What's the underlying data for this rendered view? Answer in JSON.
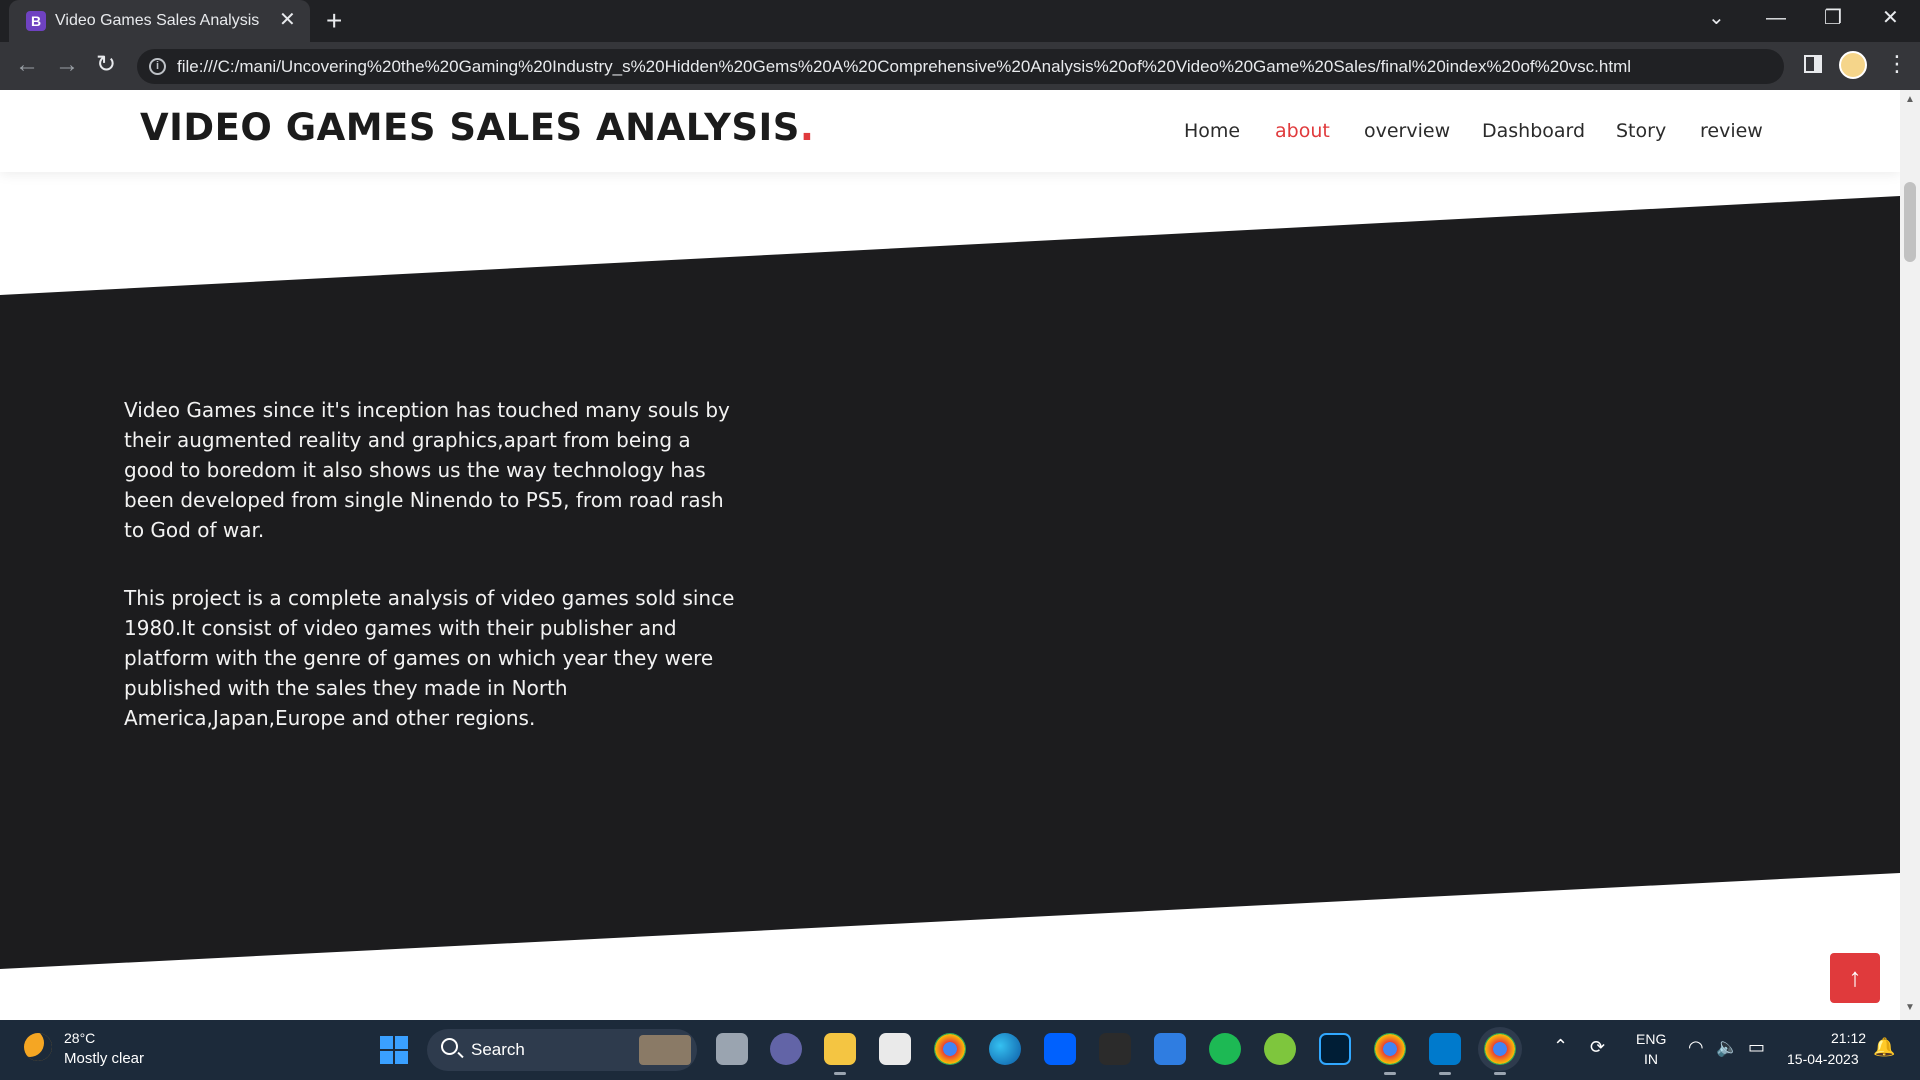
{
  "browser": {
    "tab_title": "Video Games Sales Analysis",
    "tab_favicon_letter": "B",
    "url": "file:///C:/mani/Uncovering%20the%20Gaming%20Industry_s%20Hidden%20Gems%20A%20Comprehensive%20Analysis%20of%20Video%20Game%20Sales/final%20index%20of%20vsc.html"
  },
  "site": {
    "logo_text": "VIDEO GAMES SALES ANALYSIS",
    "logo_dot": ".",
    "nav": [
      {
        "label": "Home",
        "active": false
      },
      {
        "label": "about",
        "active": true
      },
      {
        "label": "overview",
        "active": false
      },
      {
        "label": "Dashboard",
        "active": false
      },
      {
        "label": "Story",
        "active": false
      },
      {
        "label": "review",
        "active": false
      }
    ],
    "about_paragraphs": [
      "Video Games since it's inception has touched many souls by their augmented reality and graphics,apart from being a good to boredom it also shows us the way technology has been developed from single Ninendo to PS5, from road rash to God of war.",
      "This project is a complete analysis of video games sold since 1980.It consist of video games with their publisher and platform with the genre of games on which year they were published with the sales they made in North America,Japan,Europe and other regions."
    ],
    "back_to_top_icon": "arrow-up-icon"
  },
  "taskbar": {
    "weather_temp": "28°C",
    "weather_condition": "Mostly clear",
    "search_label": "Search",
    "pinned_apps": [
      "task-view",
      "teams-chat",
      "file-explorer",
      "microsoft-store",
      "chrome",
      "edge",
      "dropbox",
      "app-s",
      "mail",
      "spotify",
      "utorrent",
      "photoshop",
      "chrome-alt",
      "vscode",
      "chrome-active"
    ],
    "language_line1": "ENG",
    "language_line2": "IN",
    "time": "21:12",
    "date": "15-04-2023"
  },
  "colors": {
    "accent_red": "#e03a3c",
    "dark_band": "#1c1c1e",
    "chrome_dark": "#202124",
    "taskbar": "#1c2a3a"
  }
}
